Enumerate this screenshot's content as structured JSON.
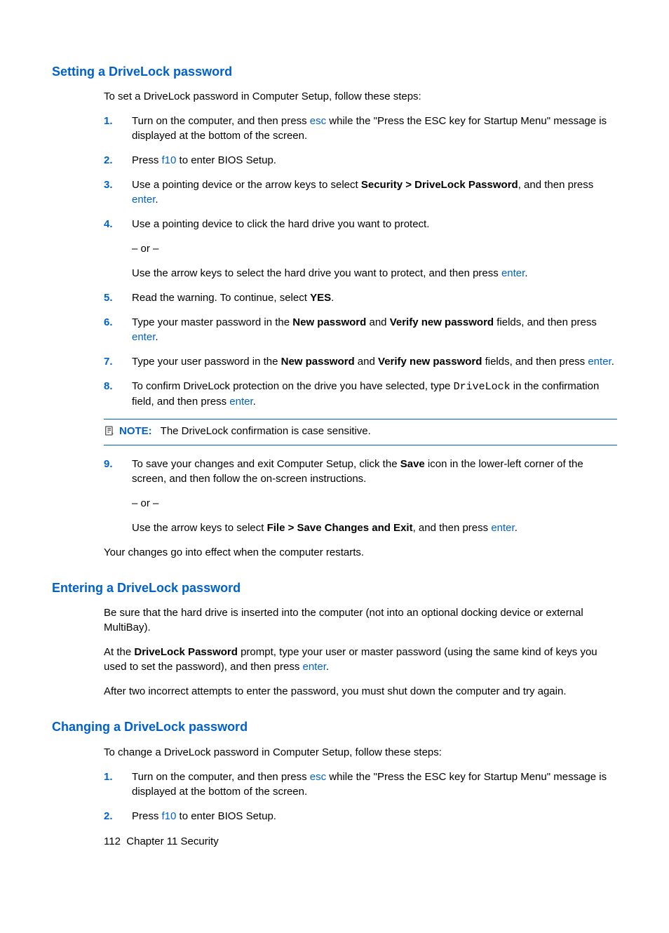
{
  "section1": {
    "heading": "Setting a DriveLock password",
    "intro": "To set a DriveLock password in Computer Setup, follow these steps:",
    "steps": {
      "s1": {
        "num": "1.",
        "t1": "Turn on the computer, and then press ",
        "k1": "esc",
        "t2": " while the \"Press the ESC key for Startup Menu\" message is displayed at the bottom of the screen."
      },
      "s2": {
        "num": "2.",
        "t1": "Press ",
        "k1": "f10",
        "t2": " to enter BIOS Setup."
      },
      "s3": {
        "num": "3.",
        "t1": "Use a pointing device or the arrow keys to select ",
        "b1": "Security > DriveLock Password",
        "t2": ", and then press ",
        "k1": "enter",
        "t3": "."
      },
      "s4": {
        "num": "4.",
        "t1": "Use a pointing device to click the hard drive you want to protect.",
        "or": "– or –",
        "t2": "Use the arrow keys to select the hard drive you want to protect, and then press ",
        "k1": "enter",
        "t3": "."
      },
      "s5": {
        "num": "5.",
        "t1": "Read the warning. To continue, select ",
        "b1": "YES",
        "t2": "."
      },
      "s6": {
        "num": "6.",
        "t1": "Type your master password in the ",
        "b1": "New password",
        "t2": " and ",
        "b2": "Verify new password",
        "t3": " fields, and then press ",
        "k1": "enter",
        "t4": "."
      },
      "s7": {
        "num": "7.",
        "t1": "Type your user password in the ",
        "b1": "New password",
        "t2": " and ",
        "b2": "Verify new password",
        "t3": " fields, and then press ",
        "k1": "enter",
        "t4": "."
      },
      "s8": {
        "num": "8.",
        "t1": "To confirm DriveLock protection on the drive you have selected, type ",
        "m1": "DriveLock",
        "t2": " in the confirmation field, and then press ",
        "k1": "enter",
        "t3": "."
      },
      "s9": {
        "num": "9.",
        "t1": "To save your changes and exit Computer Setup, click the ",
        "b1": "Save",
        "t2": " icon in the lower-left corner of the screen, and then follow the on-screen instructions.",
        "or": "– or –",
        "t3": "Use the arrow keys to select ",
        "b2": "File > Save Changes and Exit",
        "t4": ", and then press ",
        "k1": "enter",
        "t5": "."
      }
    },
    "note": {
      "label": "NOTE:",
      "text": "The DriveLock confirmation is case sensitive."
    },
    "outro": "Your changes go into effect when the computer restarts."
  },
  "section2": {
    "heading": "Entering a DriveLock password",
    "p1": "Be sure that the hard drive is inserted into the computer (not into an optional docking device or external MultiBay).",
    "p2a": "At the ",
    "p2b": "DriveLock Password",
    "p2c": " prompt, type your user or master password (using the same kind of keys you used to set the password), and then press ",
    "p2k": "enter",
    "p2d": ".",
    "p3": "After two incorrect attempts to enter the password, you must shut down the computer and try again."
  },
  "section3": {
    "heading": "Changing a DriveLock password",
    "intro": "To change a DriveLock password in Computer Setup, follow these steps:",
    "steps": {
      "s1": {
        "num": "1.",
        "t1": "Turn on the computer, and then press ",
        "k1": "esc",
        "t2": " while the \"Press the ESC key for Startup Menu\" message is displayed at the bottom of the screen."
      },
      "s2": {
        "num": "2.",
        "t1": "Press ",
        "k1": "f10",
        "t2": " to enter BIOS Setup."
      }
    }
  },
  "footer": {
    "page": "112",
    "chapter": "Chapter 11   Security"
  }
}
